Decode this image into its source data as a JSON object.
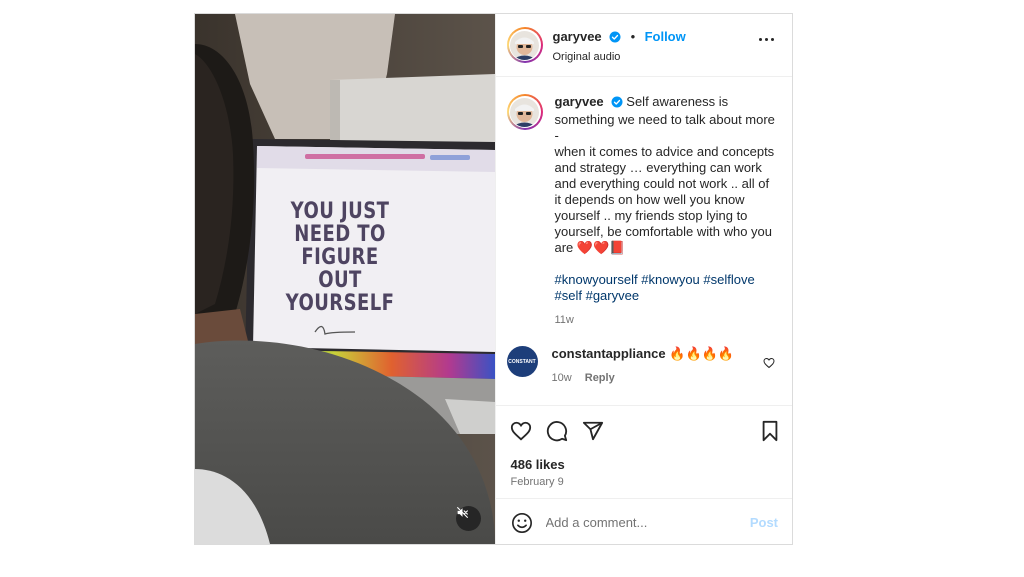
{
  "media": {
    "sign_lines": [
      "YOU JUST",
      "NEED TO",
      "FIGURE",
      "OUT",
      "YOURSELF"
    ],
    "mute_icon": "speaker-muted-icon"
  },
  "header": {
    "username": "garyvee",
    "verified_icon": "verified-badge-icon",
    "separator": "•",
    "follow_label": "Follow",
    "audio_label": "Original audio",
    "more_icon": "more-horizontal-icon"
  },
  "caption": {
    "username": "garyvee",
    "text": "Self awareness is something we need to talk about more\n-\nwhen it comes to advice and concepts and strategy … everything can work and everything could not work .. all of it depends on how well you know yourself .. my friends stop lying to yourself, be comfortable with who you are ❤️❤️📕",
    "hashtags": [
      "#knowyourself",
      "#knowyou",
      "#selflove",
      "#self",
      "#garyvee"
    ],
    "time": "11w"
  },
  "comments": [
    {
      "username": "constantappliance",
      "text": "🔥🔥🔥🔥",
      "time": "10w",
      "reply_label": "Reply",
      "avatar_text": "CONSTANT"
    }
  ],
  "actions": {
    "like_icon": "heart-icon",
    "comment_icon": "comment-bubble-icon",
    "share_icon": "paper-plane-icon",
    "save_icon": "bookmark-icon"
  },
  "stats": {
    "likes": "486 likes",
    "date": "February 9"
  },
  "add_comment": {
    "placeholder": "Add a comment...",
    "post_label": "Post",
    "emoji_icon": "smiley-icon"
  },
  "colors": {
    "accent": "#0095f6",
    "hashtag": "#00376b",
    "secondary_text": "#737373",
    "border": "#dbdbdb"
  }
}
